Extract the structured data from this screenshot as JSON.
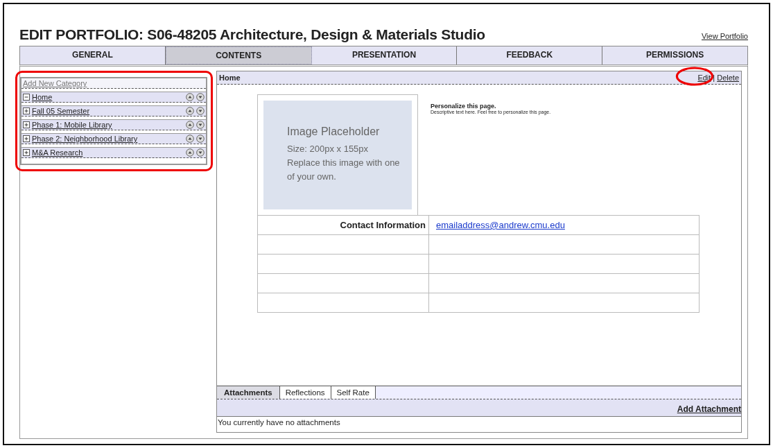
{
  "title": "EDIT PORTFOLIO: S06-48205 Architecture, Design & Materials Studio",
  "view_link": "View Portfolio",
  "tabs": [
    {
      "label": "GENERAL",
      "selected": false
    },
    {
      "label": "CONTENTS",
      "selected": true
    },
    {
      "label": "PRESENTATION",
      "selected": false
    },
    {
      "label": "FEEDBACK",
      "selected": false
    },
    {
      "label": "PERMISSIONS",
      "selected": false
    }
  ],
  "sidebar": {
    "add_link": "Add New Category",
    "items": [
      {
        "label": "Home",
        "expanded": true
      },
      {
        "label": "Fall 05 Semester",
        "expanded": false
      },
      {
        "label": "Phase 1: Mobile Library",
        "expanded": false
      },
      {
        "label": "Phase 2: Neighborhood Library",
        "expanded": false
      },
      {
        "label": "M&A Research",
        "expanded": false
      }
    ]
  },
  "page": {
    "title": "Home",
    "edit": "Edit",
    "separator": "|",
    "delete": "Delete",
    "image_placeholder": {
      "title": "Image Placeholder",
      "size": "Size: 200px x 155px",
      "note": "Replace this image with one of your own."
    },
    "heading": "Personalize this page.",
    "description": "Descriptive text here. Feel free to personalize this page.",
    "contact_label": "Contact Information",
    "contact_email": "emailaddress@andrew.cmu.edu"
  },
  "bottom_tabs": [
    {
      "label": "Attachments",
      "selected": true
    },
    {
      "label": "Reflections",
      "selected": false
    },
    {
      "label": "Self Rate",
      "selected": false
    }
  ],
  "add_attachment": "Add Attachment",
  "attachments_message": "You currently have no attachments"
}
